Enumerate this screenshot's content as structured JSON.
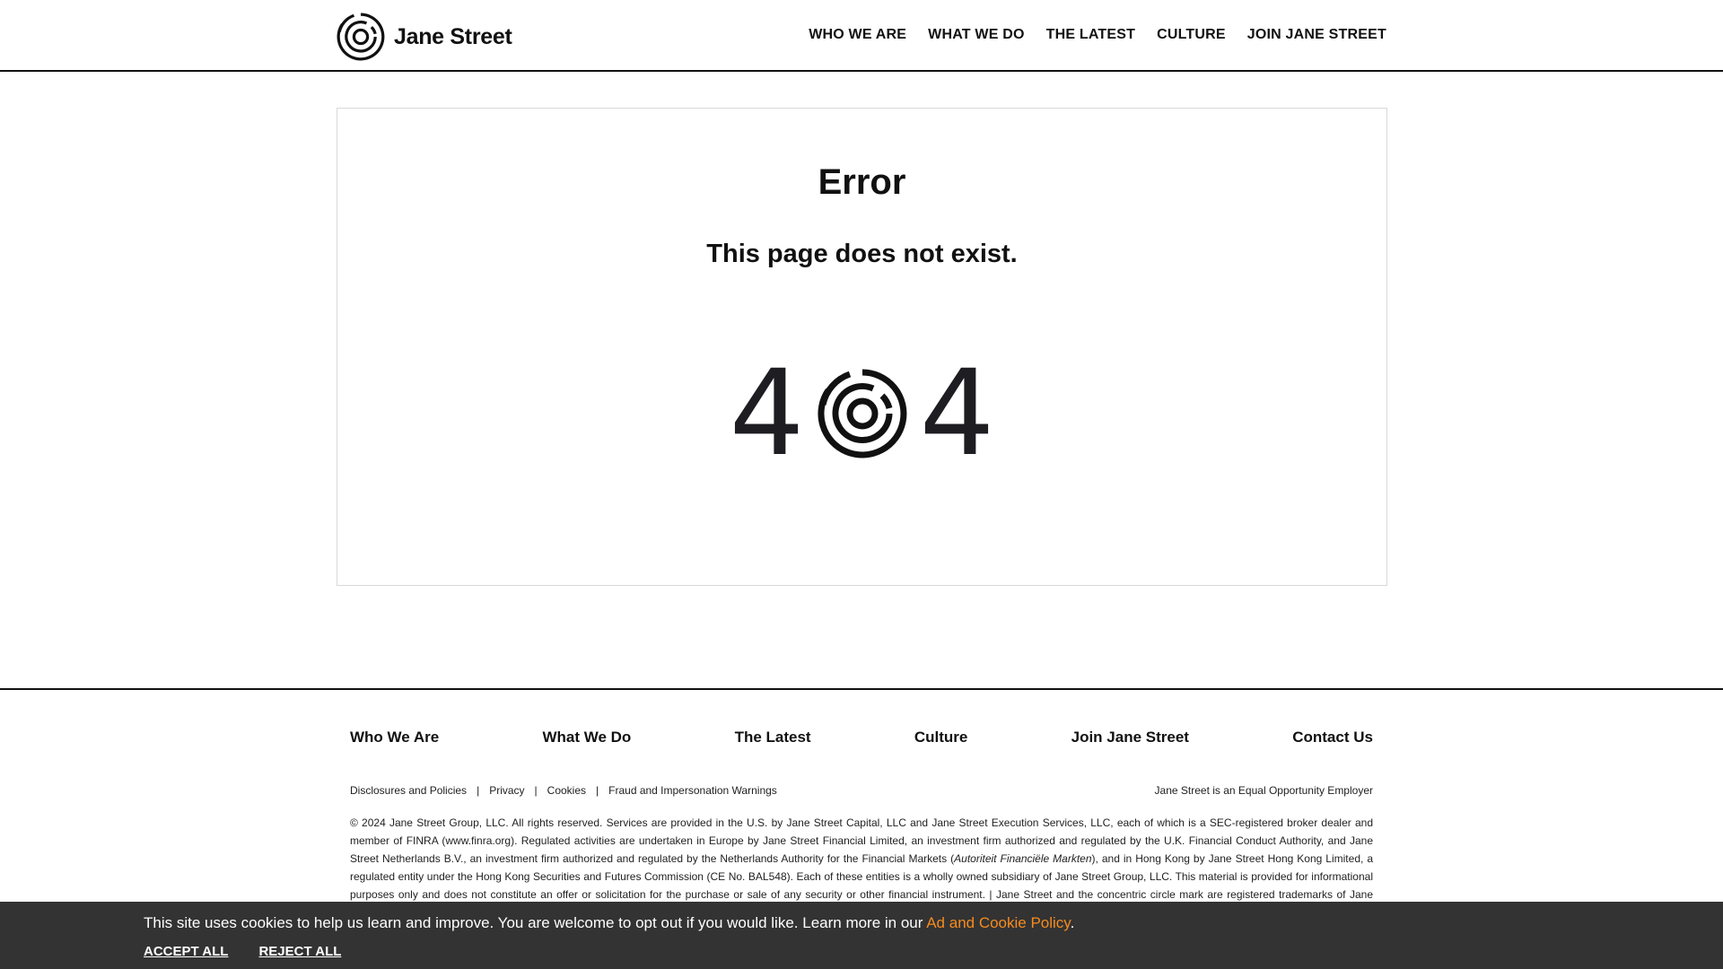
{
  "header": {
    "logo_text": "Jane Street",
    "nav": [
      "WHO WE ARE",
      "WHAT WE DO",
      "THE LATEST",
      "CULTURE",
      "JOIN JANE STREET"
    ]
  },
  "error": {
    "title": "Error",
    "message": "This page does not exist.",
    "code_left": "4",
    "code_right": "4"
  },
  "footer": {
    "nav": [
      "Who We Are",
      "What We Do",
      "The Latest",
      "Culture",
      "Join Jane Street",
      "Contact Us"
    ],
    "legal_links": [
      "Disclosures and Policies",
      "Privacy",
      "Cookies",
      "Fraud and Impersonation Warnings"
    ],
    "separator": "|",
    "eoe": "Jane Street is an Equal Opportunity Employer",
    "copyright_part1": "© 2024 Jane Street Group, LLC. All rights reserved. Services are provided in the U.S. by Jane Street Capital, LLC and Jane Street Execution Services, LLC, each of which is a SEC-registered broker dealer and member of FINRA (www.finra.org). Regulated activities are undertaken in Europe by Jane Street Financial Limited, an investment firm authorized and regulated by the U.K. Financial Conduct Authority, and Jane Street Netherlands B.V., an investment firm authorized and regulated by the Netherlands Authority for the Financial Markets (",
    "copyright_italic": "Autoriteit Financiële Markten",
    "copyright_part2": "), and in Hong Kong by Jane Street Hong Kong Limited, a regulated entity under the Hong Kong Securities and Futures Commission (CE No. BAL548). Each of these entities is a wholly owned subsidiary of Jane Street Group, LLC. This material is provided for informational purposes only and does not constitute an offer or solicitation for the purchase or sale of any security or other financial instrument.  |  Jane Street and the concentric circle mark are registered trademarks of Jane Street."
  },
  "cookie": {
    "message": "This site uses cookies to help us learn and improve. You are welcome to opt out if you would like. Learn more in our ",
    "policy_link": "Ad and Cookie Policy",
    "period": ".",
    "accept": "ACCEPT ALL",
    "reject": "REJECT ALL"
  },
  "colors": {
    "cookie_bg": "#333333",
    "link_accent": "#f68b1f",
    "text": "#111111"
  },
  "icons": {
    "logo_mark": "concentric-circle-logo-icon",
    "zero_mark": "concentric-circle-logo-icon"
  }
}
